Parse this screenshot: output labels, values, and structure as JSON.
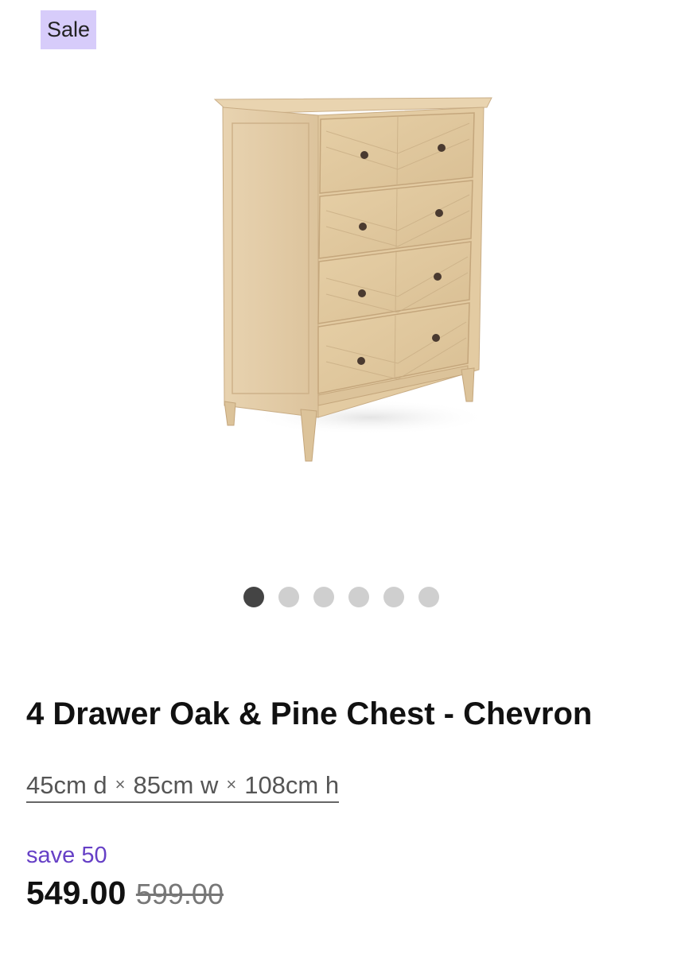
{
  "badge": {
    "label": "Sale",
    "color": "#d7ccfa"
  },
  "product": {
    "image_icon": "chest-of-drawers-image",
    "title": "4 Drawer Oak & Pine Chest - Chevron",
    "dimensions": {
      "depth": "45cm d",
      "width": "85cm w",
      "height": "108cm h",
      "separator": "×"
    },
    "save_text": "save 50",
    "price": "549.00",
    "original_price": "599.00"
  },
  "carousel": {
    "count": 6,
    "active_index": 0,
    "active_color": "#444444",
    "inactive_color": "#cfcfcf"
  },
  "colors": {
    "accent": "#6640c6"
  }
}
